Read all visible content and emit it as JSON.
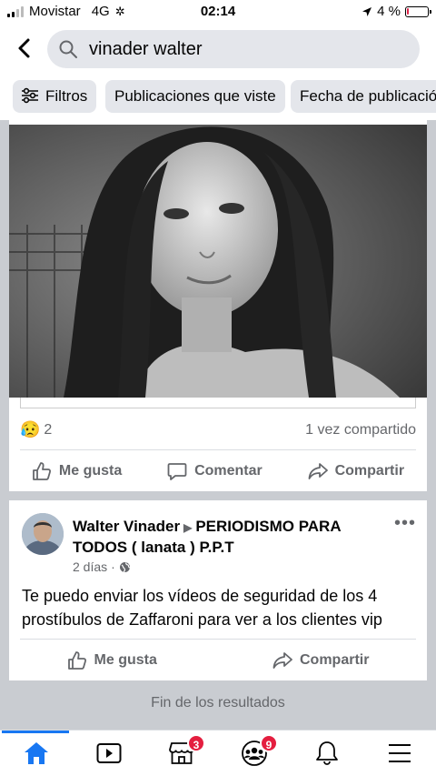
{
  "status_bar": {
    "carrier": "Movistar",
    "network": "4G",
    "time": "02:14",
    "battery_percent": "4 %",
    "battery_level": 0.04
  },
  "search": {
    "query": "vinader walter",
    "back_icon": "chevron-left-icon",
    "search_icon": "search-icon"
  },
  "filters": [
    {
      "label": "Filtros",
      "icon": "sliders-icon"
    },
    {
      "label": "Publicaciones que viste"
    },
    {
      "label": "Fecha de publicación"
    }
  ],
  "post1": {
    "reaction_emoji": "😥",
    "reaction_count": "2",
    "shares": "1 vez compartido",
    "actions": {
      "like": "Me gusta",
      "comment": "Comentar",
      "share": "Compartir"
    }
  },
  "post2": {
    "author": "Walter Vinader",
    "group": "PERIODISMO PARA TODOS ( lanata ) P.P.T",
    "time": "2 días",
    "separator": "·",
    "text": "Te puedo enviar los vídeos de seguridad de los 4 prostíbulos de Zaffaroni para ver a los clientes vip",
    "actions": {
      "like": "Me gusta",
      "share": "Compartir"
    }
  },
  "end_of_results": "Fin de los resultados",
  "bottom_nav": {
    "items": [
      "home-icon",
      "video-icon",
      "marketplace-icon",
      "groups-icon",
      "bell-icon",
      "menu-icon"
    ],
    "marketplace_badge": "3",
    "groups_badge": "9"
  },
  "colors": {
    "accent": "#1877f2",
    "badge": "#e41e3f",
    "chip_bg": "#e4e6eb",
    "feed_bg": "#c9ccd1"
  }
}
